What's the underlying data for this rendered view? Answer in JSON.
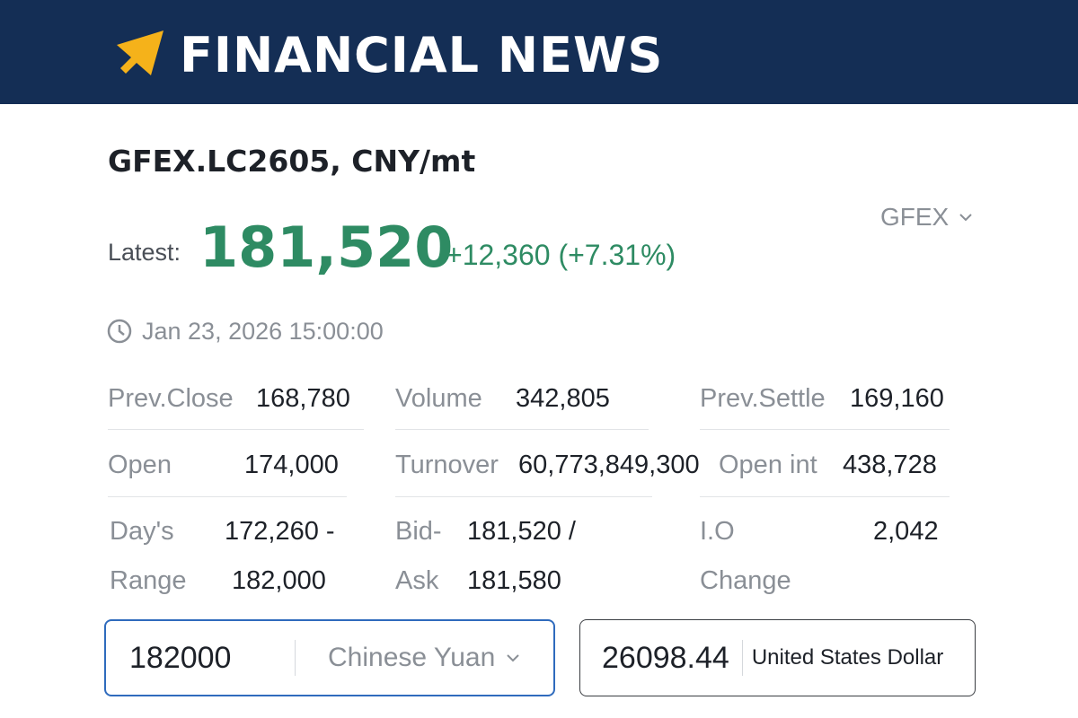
{
  "header": {
    "brand": "FINANCIAL NEWS",
    "logo_icon": "arrow-up-right-icon",
    "background_color": "#142e55",
    "accent_color": "#f5b21a"
  },
  "quote": {
    "title": "GFEX.LC2605, CNY/mt",
    "latest_label": "Latest:",
    "latest_price": "181,520",
    "change": "+12,360 (+7.31%)",
    "positive_color": "#2e8b63",
    "timestamp": "Jan 23, 2026 15:00:00",
    "clock_icon": "clock-icon"
  },
  "exchange_select": {
    "value": "GFEX",
    "icon": "chevron-down-icon"
  },
  "stats": {
    "prev_close": {
      "label": "Prev.Close",
      "value": "168,780"
    },
    "volume": {
      "label": "Volume",
      "value": "342,805"
    },
    "prev_settle": {
      "label": "Prev.Settle",
      "value": "169,160"
    },
    "open": {
      "label": "Open",
      "value": "174,000"
    },
    "turnover": {
      "label": "Turnover",
      "value": "60,773,849,300"
    },
    "open_int": {
      "label": "Open int",
      "value": "438,728"
    },
    "days_range": {
      "label_line1": "Day's",
      "label_line2": "Range",
      "value_line1": "172,260 -",
      "value_line2": "182,000"
    },
    "bid_ask": {
      "label_line1": "Bid-",
      "label_line2": "Ask",
      "value_line1": "181,520 /",
      "value_line2": "181,580"
    },
    "io_change": {
      "label_line1": "I.O",
      "label_line2": "Change",
      "value": "2,042"
    }
  },
  "converter": {
    "input_value": "182000",
    "input_currency": "Chinese Yuan",
    "output_value": "26098.44",
    "output_currency": "United States Dollar",
    "active_border_color": "#2f6bbd"
  }
}
